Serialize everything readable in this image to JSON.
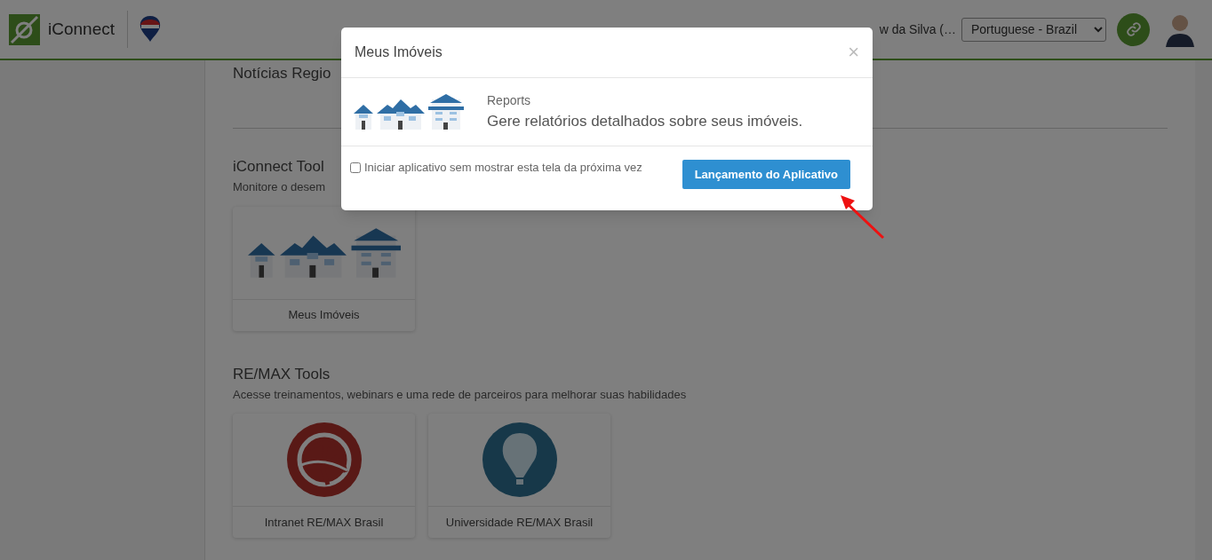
{
  "header": {
    "app_name": "iConnect",
    "user_name": "w da Silva (…",
    "language": "Portuguese - Brazil"
  },
  "sections": [
    {
      "title": "Notícias Regio"
    },
    {
      "title": "iConnect Tool",
      "subtitle": "Monitore o desem",
      "cards": [
        {
          "label": "Meus Imóveis",
          "kind": "houses"
        }
      ]
    },
    {
      "title": "RE/MAX Tools",
      "subtitle": "Acesse treinamentos, webinars e uma rede de parceiros para melhorar suas habilidades",
      "cards": [
        {
          "label": "Intranet RE/MAX Brasil",
          "kind": "network"
        },
        {
          "label": "Universidade RE/MAX Brasil",
          "kind": "balloon"
        }
      ]
    }
  ],
  "modal": {
    "title": "Meus Imóveis",
    "close": "×",
    "category": "Reports",
    "description": "Gere relatórios detalhados sobre seus imóveis.",
    "checkbox": {
      "label": "Iniciar aplicativo sem mostrar esta tela da próxima vez",
      "checked": false
    },
    "button": "Lançamento do Aplicativo"
  }
}
